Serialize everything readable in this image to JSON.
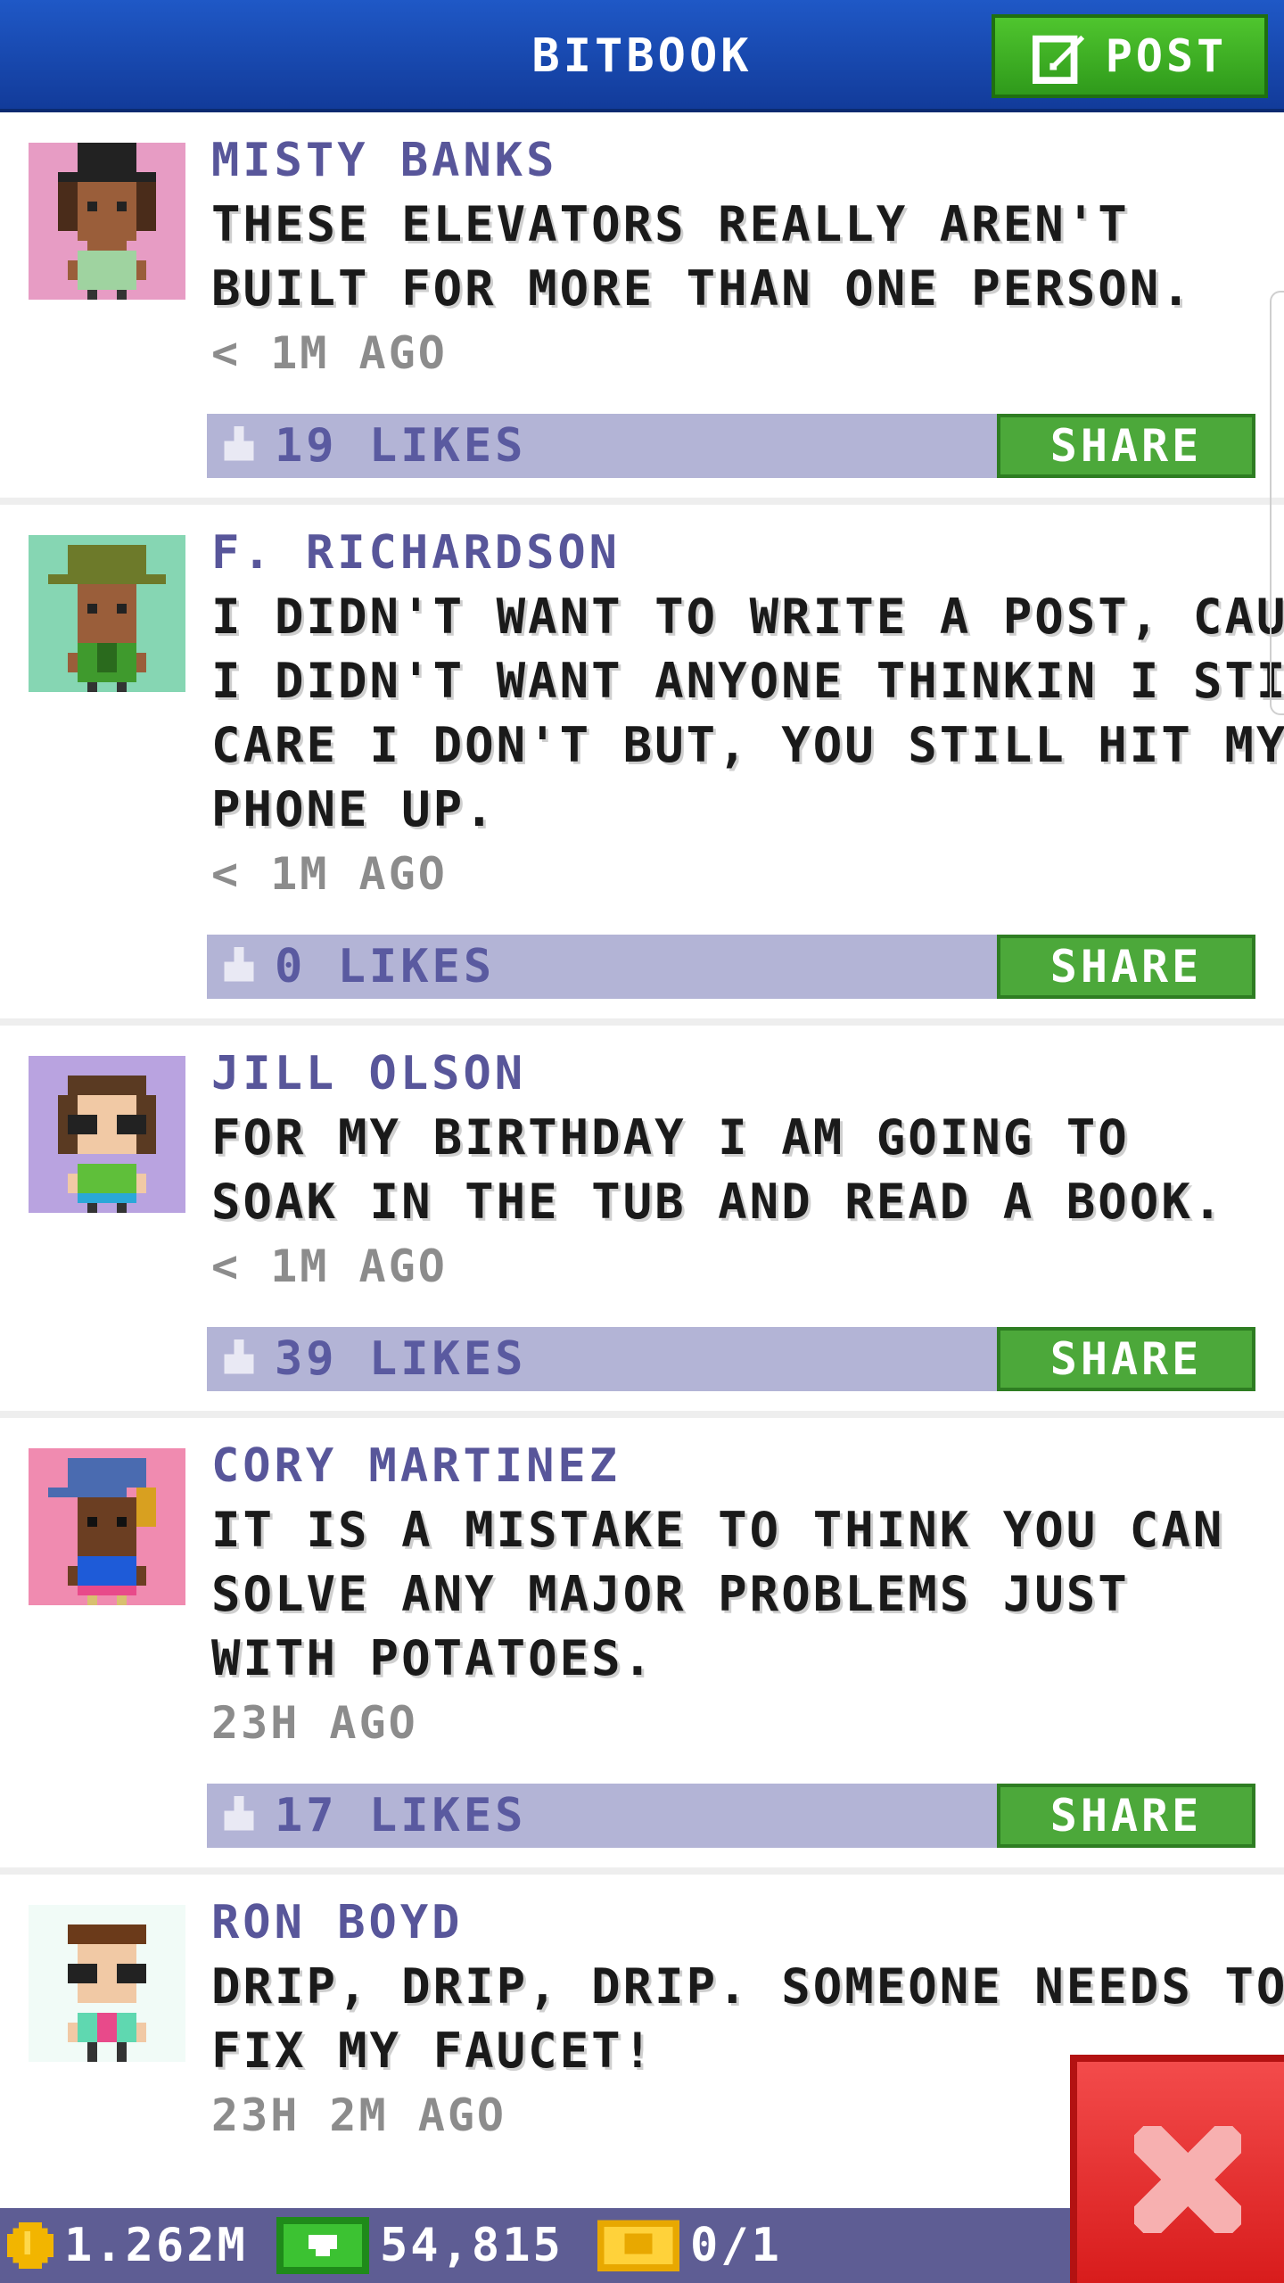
{
  "header": {
    "title": "BITBOOK",
    "post_label": "POST",
    "icon": "edit-icon"
  },
  "posts": [
    {
      "author": "MISTY BANKS",
      "lines": [
        "THESE ELEVATORS REALLY AREN'T",
        "BUILT FOR MORE THAN ONE PERSON."
      ],
      "time": "< 1M AGO",
      "likes": "19 LIKES",
      "share_label": "SHARE",
      "avatar_bg": "#e79cc4"
    },
    {
      "author": "F. RICHARDSON",
      "lines": [
        "I DIDN'T WANT TO WRITE A POST, CAUSE",
        "I DIDN'T WANT ANYONE THINKIN I STILL",
        "CARE I DON'T BUT, YOU STILL HIT MY",
        "PHONE UP."
      ],
      "time": "< 1M AGO",
      "likes": "0 LIKES",
      "share_label": "SHARE",
      "avatar_bg": "#86d6b3"
    },
    {
      "author": "JILL OLSON",
      "lines": [
        "FOR MY BIRTHDAY I AM GOING TO",
        "SOAK IN THE TUB AND READ A BOOK."
      ],
      "time": "< 1M AGO",
      "likes": "39 LIKES",
      "share_label": "SHARE",
      "avatar_bg": "#b9a3e0"
    },
    {
      "author": "CORY MARTINEZ",
      "lines": [
        "IT IS A MISTAKE TO THINK YOU CAN",
        "SOLVE ANY MAJOR PROBLEMS JUST",
        "WITH POTATOES."
      ],
      "time": "23H AGO",
      "likes": "17 LIKES",
      "share_label": "SHARE",
      "avatar_bg": "#f08bb0"
    },
    {
      "author": "RON BOYD",
      "lines": [
        "DRIP, DRIP, DRIP. SOMEONE NEEDS TO",
        "FIX MY FAUCET!"
      ],
      "time": "23H 2M AGO",
      "likes": "",
      "share_label": "",
      "avatar_bg": "#f1fbf7"
    }
  ],
  "bottom_bar": {
    "coins": "1.262M",
    "bux": "54,815",
    "tickets": "0/1"
  },
  "colors": {
    "header_blue": "#1a4bb3",
    "accent_green": "#4ca83a",
    "like_bar": "#b3b4d6",
    "author_purple": "#58569a",
    "close_red": "#e53030"
  }
}
